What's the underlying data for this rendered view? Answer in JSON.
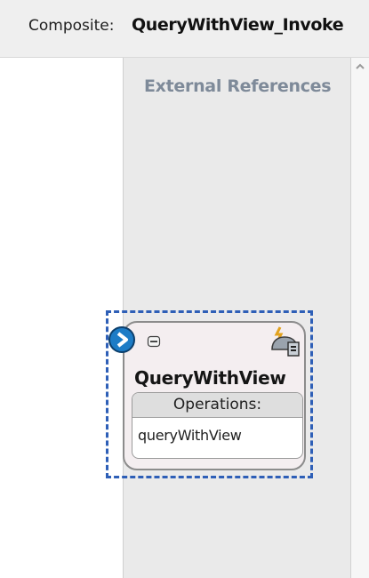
{
  "composite": {
    "label": "Composite:",
    "name": "QueryWithView_Invoke"
  },
  "lane": {
    "title": "External References"
  },
  "component": {
    "name": "QueryWithView",
    "operations_header": "Operations:",
    "operations": [
      "queryWithView"
    ],
    "icons": {
      "entry": "service-entry-icon",
      "collapse": "collapse-icon",
      "adapter": "database-adapter-icon"
    }
  },
  "colors": {
    "selection": "#2e5fb7",
    "lane_title": "#7e8a99",
    "entry_icon": "#1d7cc6"
  }
}
